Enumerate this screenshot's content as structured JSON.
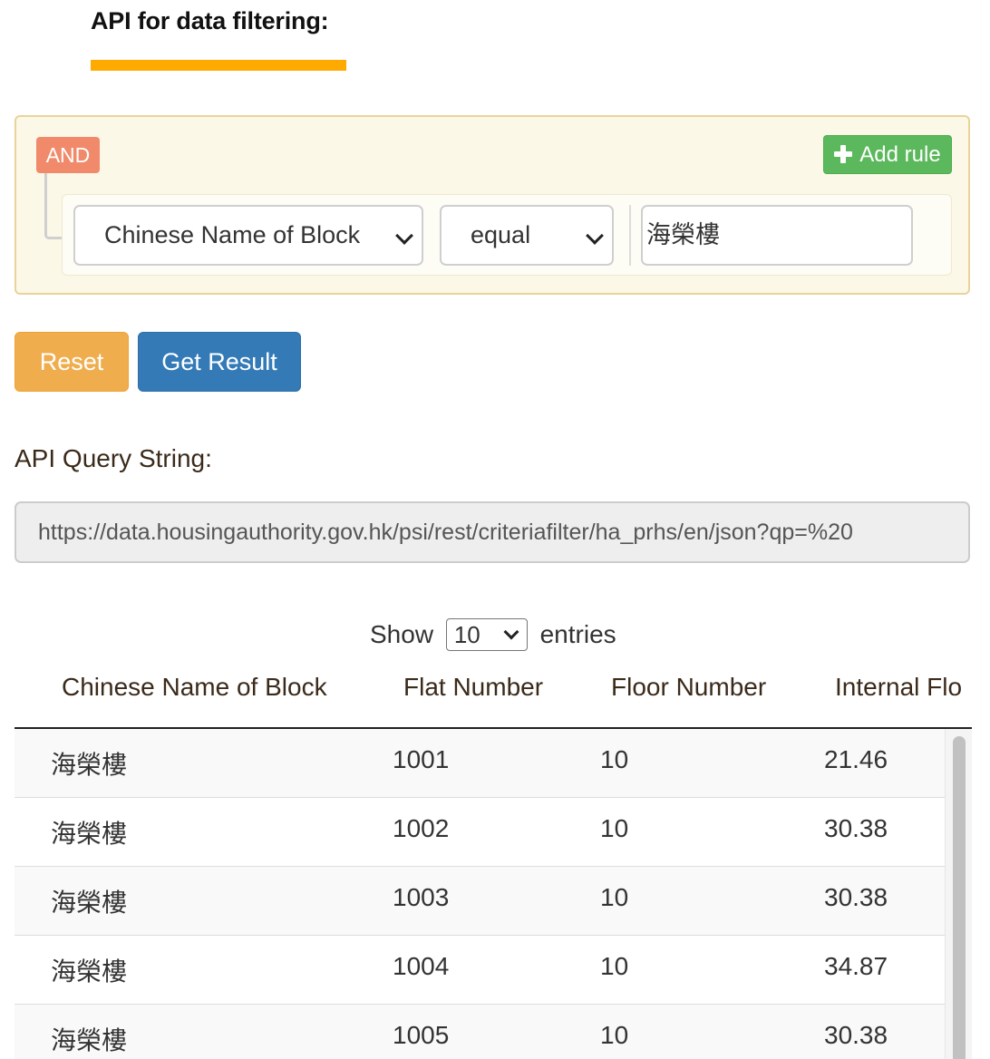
{
  "heading": "API for data filtering:",
  "builder": {
    "condition": "AND",
    "add_rule_label": "Add rule",
    "rule": {
      "field": "Chinese Name of Block",
      "operator": "equal",
      "value": "海榮樓"
    }
  },
  "actions": {
    "reset_label": "Reset",
    "get_result_label": "Get Result"
  },
  "query": {
    "label": "API Query String:",
    "value": "https://data.housingauthority.gov.hk/psi/rest/criteriafilter/ha_prhs/en/json?qp=%20"
  },
  "table": {
    "show_label": "Show",
    "page_length": "10",
    "entries_label": "entries",
    "columns": [
      "Chinese Name of Block",
      "Flat Number",
      "Floor Number",
      "Internal Flo"
    ],
    "rows": [
      [
        "海榮樓",
        "1001",
        "10",
        "21.46"
      ],
      [
        "海榮樓",
        "1002",
        "10",
        "30.38"
      ],
      [
        "海榮樓",
        "1003",
        "10",
        "30.38"
      ],
      [
        "海榮樓",
        "1004",
        "10",
        "34.87"
      ],
      [
        "海榮樓",
        "1005",
        "10",
        "30.38"
      ]
    ]
  },
  "colors": {
    "accent_underline": "#ffaa00",
    "and_badge": "#f08a6b",
    "add_rule": "#5cb85c",
    "reset": "#f0ad4e",
    "get_result": "#337ab7"
  }
}
